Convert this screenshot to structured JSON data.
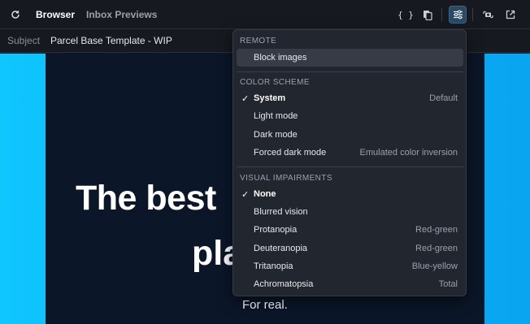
{
  "toolbar": {
    "tabs": [
      "Browser",
      "Inbox Previews"
    ],
    "braces_glyph": "{ }",
    "icons": {
      "refresh": "refresh-icon",
      "code": "code-braces-icon",
      "copy": "copy-icon",
      "settings": "sliders-icon",
      "screenshot": "camera-icon",
      "open": "external-link-icon"
    }
  },
  "subject": {
    "label": "Subject",
    "value": "Parcel Base Template - WIP"
  },
  "preview": {
    "headline_line1": "The best",
    "headline_line2": "pla",
    "subline": "For real."
  },
  "menu": {
    "remote": {
      "title": "REMOTE",
      "items": [
        {
          "label": "Block images"
        }
      ]
    },
    "color_scheme": {
      "title": "COLOR SCHEME",
      "items": [
        {
          "label": "System",
          "detail": "Default",
          "checked": true
        },
        {
          "label": "Light mode"
        },
        {
          "label": "Dark mode"
        },
        {
          "label": "Forced dark mode",
          "detail": "Emulated color inversion"
        }
      ]
    },
    "visual": {
      "title": "VISUAL IMPAIRMENTS",
      "items": [
        {
          "label": "None",
          "checked": true
        },
        {
          "label": "Blurred vision"
        },
        {
          "label": "Protanopia",
          "detail": "Red-green"
        },
        {
          "label": "Deuteranopia",
          "detail": "Red-green"
        },
        {
          "label": "Tritanopia",
          "detail": "Blue-yellow"
        },
        {
          "label": "Achromatopsia",
          "detail": "Total"
        }
      ]
    },
    "check_glyph": "✓"
  },
  "colors": {
    "accent": "#3b6686",
    "preview_gradient_start": "#0fc6ff",
    "preview_gradient_end": "#0aa4f0",
    "email_bg": "#0b1628"
  }
}
